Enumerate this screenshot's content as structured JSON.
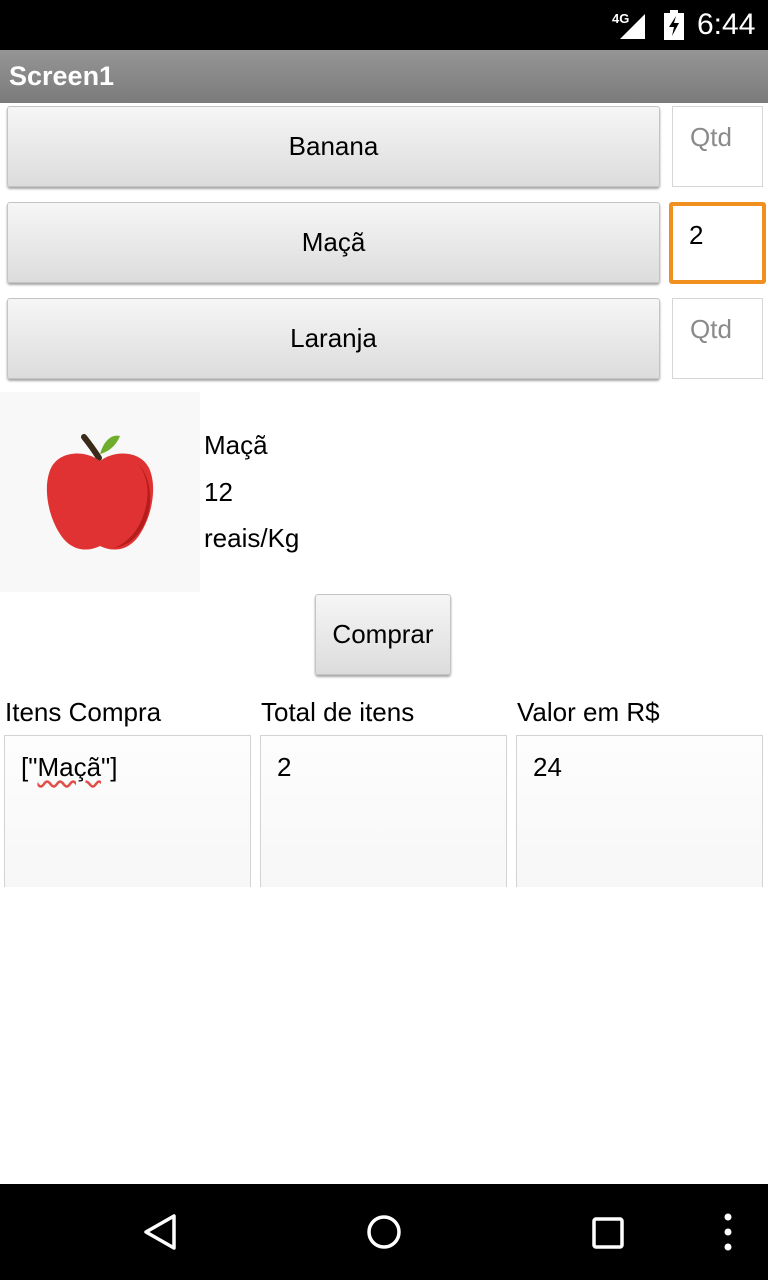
{
  "status_bar": {
    "network": "4G",
    "time": "6:44"
  },
  "app": {
    "title": "Screen1"
  },
  "fruits": [
    {
      "label": "Banana",
      "qty_value": "",
      "qty_placeholder": "Qtd"
    },
    {
      "label": "Maçã",
      "qty_value": "2",
      "qty_placeholder": "Qtd"
    },
    {
      "label": "Laranja",
      "qty_value": "",
      "qty_placeholder": "Qtd"
    }
  ],
  "selected": {
    "image_icon": "apple-icon",
    "name": "Maçã",
    "price": "12",
    "unit": "reais/Kg"
  },
  "buy_button": {
    "label": "Comprar"
  },
  "columns": {
    "items": {
      "header": "Itens Compra",
      "value_prefix": "[\"",
      "value_word": "Maçã",
      "value_suffix": "\"]"
    },
    "total": {
      "header": "Total de itens",
      "value": "2"
    },
    "amount": {
      "header": "Valor em R$",
      "value": "24"
    }
  },
  "colors": {
    "focus_border": "#f0901e",
    "apple_red": "#e03232",
    "title_bar": "#888888"
  },
  "nav_icons": [
    "back-icon",
    "home-icon",
    "recents-icon",
    "menu-icon"
  ]
}
